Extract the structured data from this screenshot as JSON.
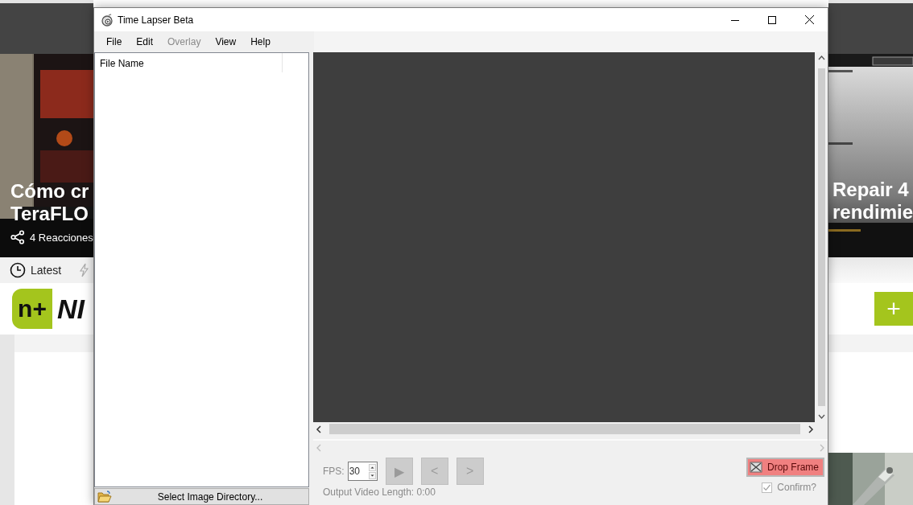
{
  "background_page": {
    "left_story": {
      "title_lines": [
        "Cómo cr",
        "TeraFLO"
      ],
      "reactions": "4 Reacciones"
    },
    "nav": {
      "latest": "Latest"
    },
    "logo": {
      "mark": "n+",
      "name": "NI"
    },
    "right_story": {
      "title_lines": [
        "Repair 4",
        "rendimie"
      ]
    },
    "add_button": "+"
  },
  "window": {
    "title": "Time Lapser Beta",
    "menu": [
      {
        "label": "File",
        "disabled": false
      },
      {
        "label": "Edit",
        "disabled": false
      },
      {
        "label": "Overlay",
        "disabled": true
      },
      {
        "label": "View",
        "disabled": false
      },
      {
        "label": "Help",
        "disabled": false
      }
    ],
    "file_list": {
      "columns": [
        "File Name"
      ]
    },
    "select_button": "Select Image Directory...",
    "fps": {
      "label": "FPS:",
      "value": "30"
    },
    "playback_buttons": [
      {
        "label": "▶",
        "disabled": true
      },
      {
        "label": "<",
        "disabled": true
      },
      {
        "label": ">",
        "disabled": true
      }
    ],
    "output_length": "Output Video Length: 0:00",
    "drop_frame": "Drop Frame",
    "confirm": {
      "label": "Confirm?",
      "checked": true,
      "disabled": true
    }
  }
}
